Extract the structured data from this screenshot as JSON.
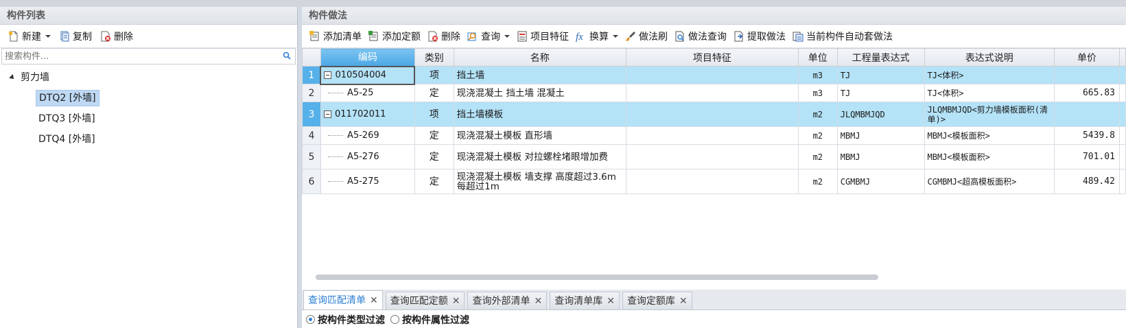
{
  "left_panel": {
    "title": "构件列表",
    "toolbar": {
      "new_label": "新建",
      "copy_label": "复制",
      "delete_label": "删除"
    },
    "search_placeholder": "搜索构件...",
    "tree": {
      "root_label": "剪力墙",
      "children": [
        "DTQ2 [外墙]",
        "DTQ3 [外墙]",
        "DTQ4 [外墙]"
      ],
      "selected_index": 0
    }
  },
  "right_panel": {
    "title": "构件做法",
    "toolbar": {
      "add_list": "添加清单",
      "add_quota": "添加定额",
      "delete": "删除",
      "query": "查询",
      "item_feature": "项目特征",
      "convert": "换算",
      "brush": "做法刷",
      "method_query": "做法查询",
      "extract": "提取做法",
      "auto_apply": "当前构件自动套做法"
    },
    "grid": {
      "headers": [
        "编码",
        "类别",
        "名称",
        "项目特征",
        "单位",
        "工程量表达式",
        "表达式说明",
        "单价"
      ],
      "rows": [
        {
          "num": "1",
          "code": "010504004",
          "type": "项",
          "name": "挡土墙",
          "feature": "",
          "unit": "m3",
          "expr": "TJ",
          "desc": "TJ<体积>",
          "price": "",
          "kind": "qd"
        },
        {
          "num": "2",
          "code": "A5-25",
          "type": "定",
          "name": "现浇混凝土 挡土墙 混凝土",
          "feature": "",
          "unit": "m3",
          "expr": "TJ",
          "desc": "TJ<体积>",
          "price": "665.83",
          "kind": "de"
        },
        {
          "num": "3",
          "code": "011702011",
          "type": "项",
          "name": "挡土墙模板",
          "feature": "",
          "unit": "m2",
          "expr": "JLQMBMJQD",
          "desc": "JLQMBMJQD<剪力墙模板面积(清单)>",
          "price": "",
          "kind": "qd"
        },
        {
          "num": "4",
          "code": "A5-269",
          "type": "定",
          "name": "现浇混凝土模板 直形墙",
          "feature": "",
          "unit": "m2",
          "expr": "MBMJ",
          "desc": "MBMJ<模板面积>",
          "price": "5439.8",
          "kind": "de"
        },
        {
          "num": "5",
          "code": "A5-276",
          "type": "定",
          "name": "现浇混凝土模板 对拉螺栓堵眼增加费",
          "feature": "",
          "unit": "m2",
          "expr": "MBMJ",
          "desc": "MBMJ<模板面积>",
          "price": "701.01",
          "kind": "de"
        },
        {
          "num": "6",
          "code": "A5-275",
          "type": "定",
          "name": "现浇混凝土模板 墙支撑 高度超过3.6m每超过1m",
          "feature": "",
          "unit": "m2",
          "expr": "CGMBMJ",
          "desc": "CGMBMJ<超高模板面积>",
          "price": "489.42",
          "kind": "de"
        }
      ]
    },
    "bottom_tabs": [
      "查询匹配清单",
      "查询匹配定额",
      "查询外部清单",
      "查询清单库",
      "查询定额库"
    ],
    "active_tab": 0,
    "filter": {
      "option1": "按构件类型过滤",
      "option2": "按构件属性过滤"
    }
  },
  "colors": {
    "accent": "#2d7fd3",
    "selected_row": "#b4e2f7",
    "header_code": "#4aa7e6"
  }
}
